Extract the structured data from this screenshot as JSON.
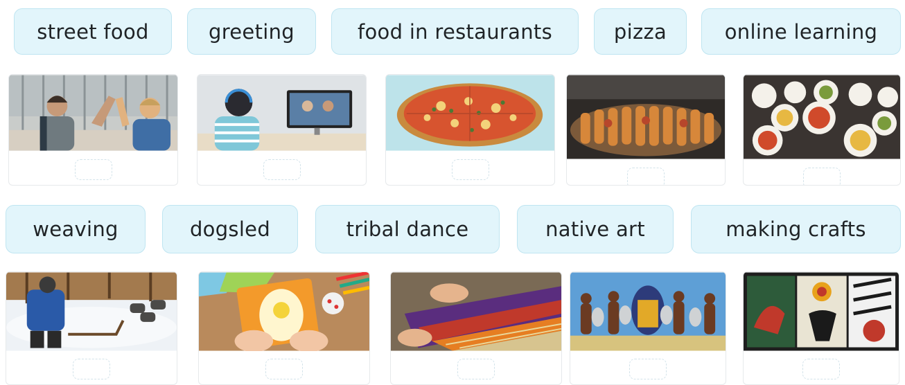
{
  "row1_words": [
    "street food",
    "greeting",
    "food in restaurants",
    "pizza",
    "online learning"
  ],
  "row2_words": [
    "weaving",
    "dogsled",
    "tribal dance",
    "native art",
    "making crafts"
  ],
  "row1_pictures": [
    {
      "name": "greeting-photo"
    },
    {
      "name": "online-learning-photo"
    },
    {
      "name": "pizza-photo"
    },
    {
      "name": "street-food-photo"
    },
    {
      "name": "restaurant-food-photo"
    }
  ],
  "row2_pictures": [
    {
      "name": "dogsled-photo"
    },
    {
      "name": "making-crafts-photo"
    },
    {
      "name": "weaving-photo"
    },
    {
      "name": "tribal-dance-photo"
    },
    {
      "name": "native-art-photo"
    }
  ],
  "colors": {
    "chip_fill": "#e2f5fb",
    "chip_border": "#bfe5f1",
    "slot_border": "#d3e3ea"
  }
}
